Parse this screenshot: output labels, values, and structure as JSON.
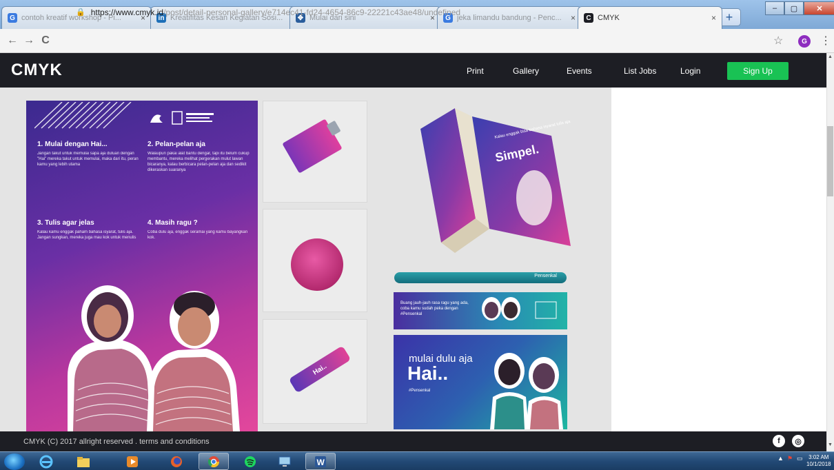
{
  "browser": {
    "tabs": [
      {
        "title": "contoh kreatif workshop - Pi...",
        "favicon": "G",
        "color": "#3b7be0"
      },
      {
        "title": "Kreatifitas Kesan Kegiatan Sosi...",
        "favicon": "in",
        "color": "#1d6fb8"
      },
      {
        "title": "Mulai dari sini",
        "favicon": "✥",
        "color": "#2a5d9c"
      },
      {
        "title": "jeka limandu bandung - Penc...",
        "favicon": "G",
        "color": "#3b7be0"
      },
      {
        "title": "CMYK",
        "favicon": "C",
        "color": "#1d1e24"
      }
    ],
    "tab_close": "×",
    "new_tab": "+",
    "url_host": "https://www.cmyk.id",
    "url_path": "/post/detail-personal-gallery/e714ec41-fd24-4654-86c9-22221c43ae48/undefined",
    "back": "←",
    "forward": "→",
    "reload": "C",
    "star": "☆",
    "profile": "G",
    "menu": "⋮",
    "window_controls": {
      "minimize": "–",
      "maximize": "▢",
      "close": "✕"
    }
  },
  "site": {
    "logo": "CMYK",
    "nav": [
      "Print",
      "Gallery",
      "Events",
      "List Jobs",
      "Login"
    ],
    "signup": "Sign Up",
    "footer": "CMYK (C) 2017   allright reserved . terms and conditions",
    "social": {
      "facebook": "f",
      "instagram": "◎"
    }
  },
  "gallery": {
    "poster": {
      "tips": [
        {
          "title": "1. Mulai dengan Hai...",
          "body": "Jangan takut untuk memulai sapa aja duluan dengan \"Hai\" mereka takut untuk memulai, maka dari itu, peran kamu yang lebih utama"
        },
        {
          "title": "2. Pelan-pelan aja",
          "body": "Walaupun pakai alat bantu dengar, tapi itu belum cukup membantu, mereka melihat pergerakan mulut lawan bicaranya, kalau berbicara pelan-pelan aja dan sedikit dikeraskan suaranya"
        },
        {
          "title": "3. Tulis agar jelas",
          "body": "Kalau kamu enggak paham bahasa isyarat, tulis aja. Jangan sungkan, mereka juga mau kok untuk menulis"
        },
        {
          "title": "4. Masih ragu ?",
          "body": "Coba dulu aja, enggak seramai yang kamu bayangkan kok."
        }
      ]
    },
    "lip_text": "Hai..",
    "book_text": "Simpel.",
    "book_sub": "Kalau enggak bisa bahasa isyarat tulis aja",
    "pen_label": "Pensenkal",
    "banner1_text": "Buang jauh-jauh rasa ragu yang ada, coba kamu sudah peka dengan #Pensenkal",
    "banner2": {
      "small": "mulai dulu aja",
      "big": "Hai..",
      "tag": "#Pensenkal"
    }
  },
  "taskbar": {
    "apps": [
      "ie-icon",
      "explorer-icon",
      "media-player-icon",
      "firefox-icon",
      "chrome-icon",
      "spotify-icon",
      "monitor-icon",
      "word-icon"
    ],
    "time": "3:02 AM",
    "date": "10/1/2018"
  }
}
